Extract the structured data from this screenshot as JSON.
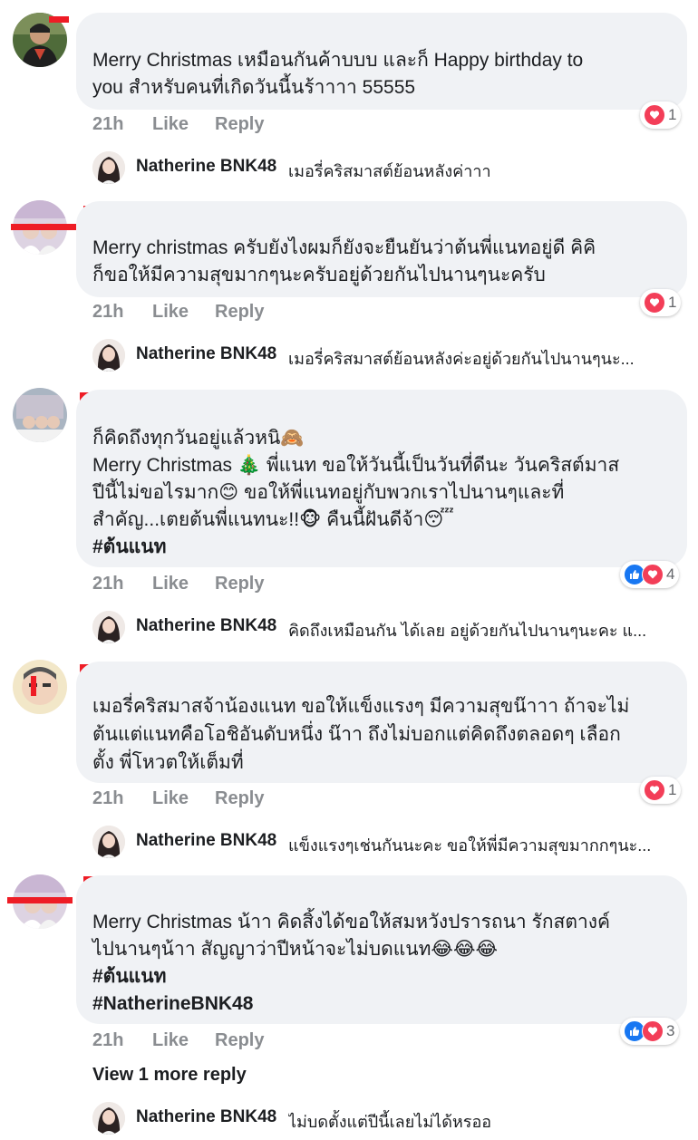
{
  "colors": {
    "bubble": "#f0f2f5",
    "meta": "#8a8d91",
    "redaction": "#ee1c25",
    "like_blue": "#1877f2",
    "love_red": "#f33e58"
  },
  "comments": [
    {
      "lines": [
        "Merry Christmas เหมือนกันค้าบบบ และก็ Happy birthday to",
        "you สำหรับคนที่เกิดวันนี้นร้าาาา 55555"
      ],
      "time": "21h",
      "like": "Like",
      "reply": "Reply",
      "reactions": {
        "icons": [
          "love-icon"
        ],
        "count": "1"
      },
      "reply_preview": {
        "name": "Natherine BNK48",
        "text": "เมอรี่คริสมาสต์ย้อนหลังค่าาา"
      }
    },
    {
      "lines": [
        "Merry christmas ครับยังไงผมก็ยังจะยืนยันว่าต้นพี่แนทอยู่ดี คิคิ",
        "ก็ขอให้มีความสุขมากๆนะครับอยู่ด้วยกันไปนานๆนะครับ"
      ],
      "time": "21h",
      "like": "Like",
      "reply": "Reply",
      "reactions": {
        "icons": [
          "love-icon"
        ],
        "count": "1"
      },
      "reply_preview": {
        "name": "Natherine BNK48",
        "text": "เมอรี่คริสมาสต์ย้อนหลังค่ะอยู่ด้วยกันไปนานๆนะ..."
      }
    },
    {
      "lines": [
        "ก็คิดถึงทุกวันอยู่แล้วหนิ🙈",
        "Merry Christmas 🎄 พี่แนท ขอให้วันนี้เป็นวันที่ดีนะ วันคริสต์มาส",
        "ปีนี้ไม่ขอไรมาก😊 ขอให้พี่แนทอยู่กับพวกเราไปนานๆและที่",
        "สำคัญ...เตยต้นพี่แนทนะ!!🐵 คืนนี้ฝันดีจ้า😴"
      ],
      "hashtags": [
        "#ต้นแนท"
      ],
      "time": "21h",
      "like": "Like",
      "reply": "Reply",
      "reactions": {
        "icons": [
          "like-icon",
          "love-icon"
        ],
        "count": "4"
      },
      "reply_preview": {
        "name": "Natherine BNK48",
        "text": "คิดถึงเหมือนกัน ได้เลย อยู่ด้วยกันไปนานๆนะคะ แ..."
      }
    },
    {
      "lines": [
        "เมอรี่คริสมาสจ้าน้องแนท ขอให้แข็งแรงๆ มีความสุขน๊าาา ถ้าจะไม่",
        "ต้นแต่แนทคือโอชิอันดับหนึ่ง น๊าา ถึงไม่บอกแต่คิดถึงตลอดๆ เลือก",
        "ตั้ง พี่โหวตให้เต็มที่"
      ],
      "time": "21h",
      "like": "Like",
      "reply": "Reply",
      "reactions": {
        "icons": [
          "love-icon"
        ],
        "count": "1"
      },
      "reply_preview": {
        "name": "Natherine BNK48",
        "text": "แข็งแรงๆเช่นกันนะคะ ขอให้พี่มีความสุขมากกๆนะ..."
      }
    },
    {
      "lines": [
        "Merry Christmas น้าา คิดสิ้งได้ขอให้สมหวังปรารถนา รักสตางค์",
        "ไปนานๆน้าา สัญญาว่าปีหน้าจะไม่บดแนท😂😂😂"
      ],
      "hashtags": [
        "#ต้นแนท",
        "#NatherineBNK48"
      ],
      "time": "21h",
      "like": "Like",
      "reply": "Reply",
      "reactions": {
        "icons": [
          "like-icon",
          "love-icon"
        ],
        "count": "3"
      },
      "view_more": "View 1 more reply",
      "reply_preview": {
        "name": "Natherine BNK48",
        "text": "ไม่บดตั้งแต่ปีนี้เลยไม่ได้หรออ"
      }
    }
  ]
}
